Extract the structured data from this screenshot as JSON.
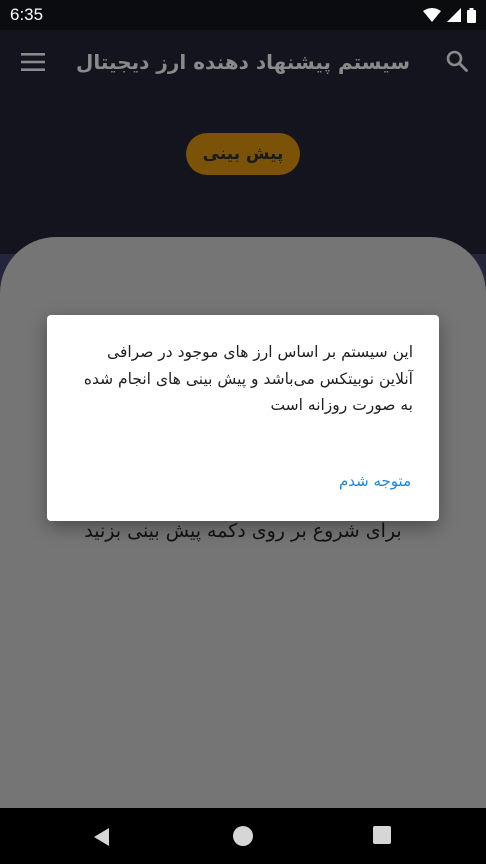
{
  "status_bar": {
    "time": "6:35",
    "icons": [
      "wifi-icon",
      "signal-icon",
      "battery-icon"
    ]
  },
  "app_bar": {
    "title": "سیستم پیشنهاد دهنده ارز دیجیتال",
    "menu_icon": "menu-icon",
    "search_icon": "search-icon"
  },
  "hero": {
    "predict_button_label": "پیش بینی"
  },
  "card": {
    "instruction": "برای شروع بر روی دکمه پیش بینی بزنید"
  },
  "dialog": {
    "message": "این سیستم بر اساس ارز های موجود در صرافی آنلاین نوبیتکس می‌باشد و پیش بینی های انجام شده به صورت روزانه است",
    "confirm_label": "متوجه شدم"
  },
  "nav_bar": {
    "icons": [
      "back-icon",
      "home-icon",
      "recents-icon"
    ]
  },
  "colors": {
    "status_bar_bg": "#0b0c0f",
    "app_bar_bg": "#13141d",
    "button_bg": "#7a5208",
    "card_bg": "#757575",
    "dialog_accent": "#1f86d1"
  }
}
